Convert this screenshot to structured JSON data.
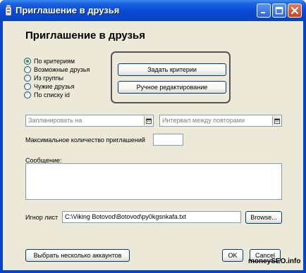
{
  "window": {
    "title": "Приглашение в друзья"
  },
  "dialog": {
    "heading": "Приглашение в друзья",
    "mode_options": [
      {
        "label": "По критериям",
        "checked": true
      },
      {
        "label": "Возможные друзья",
        "checked": false
      },
      {
        "label": "Из группы",
        "checked": false
      },
      {
        "label": "Чужие друзья",
        "checked": false
      },
      {
        "label": "По списку id",
        "checked": false
      }
    ],
    "criteria_button": "Задать критерии",
    "manual_edit_button": "Ручное редактирование",
    "schedule_placeholder": "Запланировать на",
    "interval_placeholder": "Интервал между повторами",
    "max_invites_label": "Максимальное количество приглашений",
    "max_invites_value": "",
    "message_label": "Сообщение:",
    "message_value": "",
    "ignore_label": "Игнор лист",
    "ignore_path": "C:\\Viking Botovod\\Botovod\\py0kgsnkafa.txt",
    "browse_button": "Browse...",
    "select_accounts_button": "Выбрать несколько аккаунтов",
    "ok_button": "OK",
    "cancel_button": "Cancel"
  },
  "watermark": "moneySEO.info",
  "icons": [
    "app-icon",
    "minimize-icon",
    "maximize-icon",
    "close-icon",
    "calendar-icon"
  ],
  "colors": {
    "titlebar": "#0a4cd6",
    "dialog_bg": "#ece9d8",
    "close_button": "#c8451f",
    "radio_dot": "#21a121"
  }
}
